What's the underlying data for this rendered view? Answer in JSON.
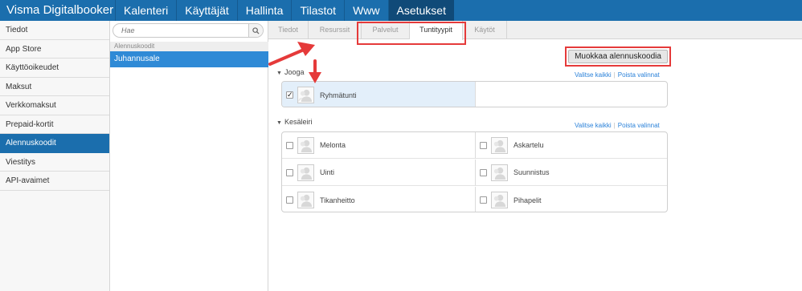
{
  "app": {
    "title": "Visma Digitalbooker"
  },
  "topnav": [
    "Kalenteri",
    "Käyttäjät",
    "Hallinta",
    "Tilastot",
    "Www",
    "Asetukset"
  ],
  "topnav_active": "Asetukset",
  "sidebar": {
    "items": [
      {
        "label": "Tiedot"
      },
      {
        "label": "App Store"
      },
      {
        "label": "Käyttöoikeudet"
      },
      {
        "label": "Maksut"
      },
      {
        "label": "Verkkomaksut"
      },
      {
        "label": "Prepaid-kortit"
      },
      {
        "label": "Alennuskoodit"
      },
      {
        "label": "Viestitys"
      },
      {
        "label": "API-avaimet"
      }
    ],
    "active": "Alennuskoodit"
  },
  "search": {
    "placeholder": "Hae",
    "value": ""
  },
  "list": {
    "header": "Alennuskoodit",
    "selected_item": "Juhannusale"
  },
  "tabs": [
    "Tiedot",
    "Resurssit",
    "Palvelut",
    "Tuntityypit",
    "Käytöt"
  ],
  "active_tab": "Tuntityypit",
  "edit_button": "Muokkaa alennuskoodia",
  "link_select_all": "Valitse kaikki",
  "link_clear": "Poista valinnat",
  "groups": [
    {
      "title": "Jooga",
      "items": [
        {
          "label": "Ryhmätunti",
          "checked": true
        }
      ]
    },
    {
      "title": "Kesäleiri",
      "items": [
        {
          "label": "Melonta",
          "checked": false
        },
        {
          "label": "Askartelu",
          "checked": false
        },
        {
          "label": "Uinti",
          "checked": false
        },
        {
          "label": "Suunnistus",
          "checked": false
        },
        {
          "label": "Tikanheitto",
          "checked": false
        },
        {
          "label": "Pihapelit",
          "checked": false
        }
      ]
    }
  ],
  "colors": {
    "topbar": "#1b6ead",
    "active_nav": "#104a78",
    "selected_list": "#2f8ad6",
    "link": "#2b82d9",
    "annotation": "#e53a3a"
  },
  "icons": {
    "search": "search-icon",
    "avatar": "avatar-placeholder-icon",
    "caret": "caret-down-icon"
  }
}
